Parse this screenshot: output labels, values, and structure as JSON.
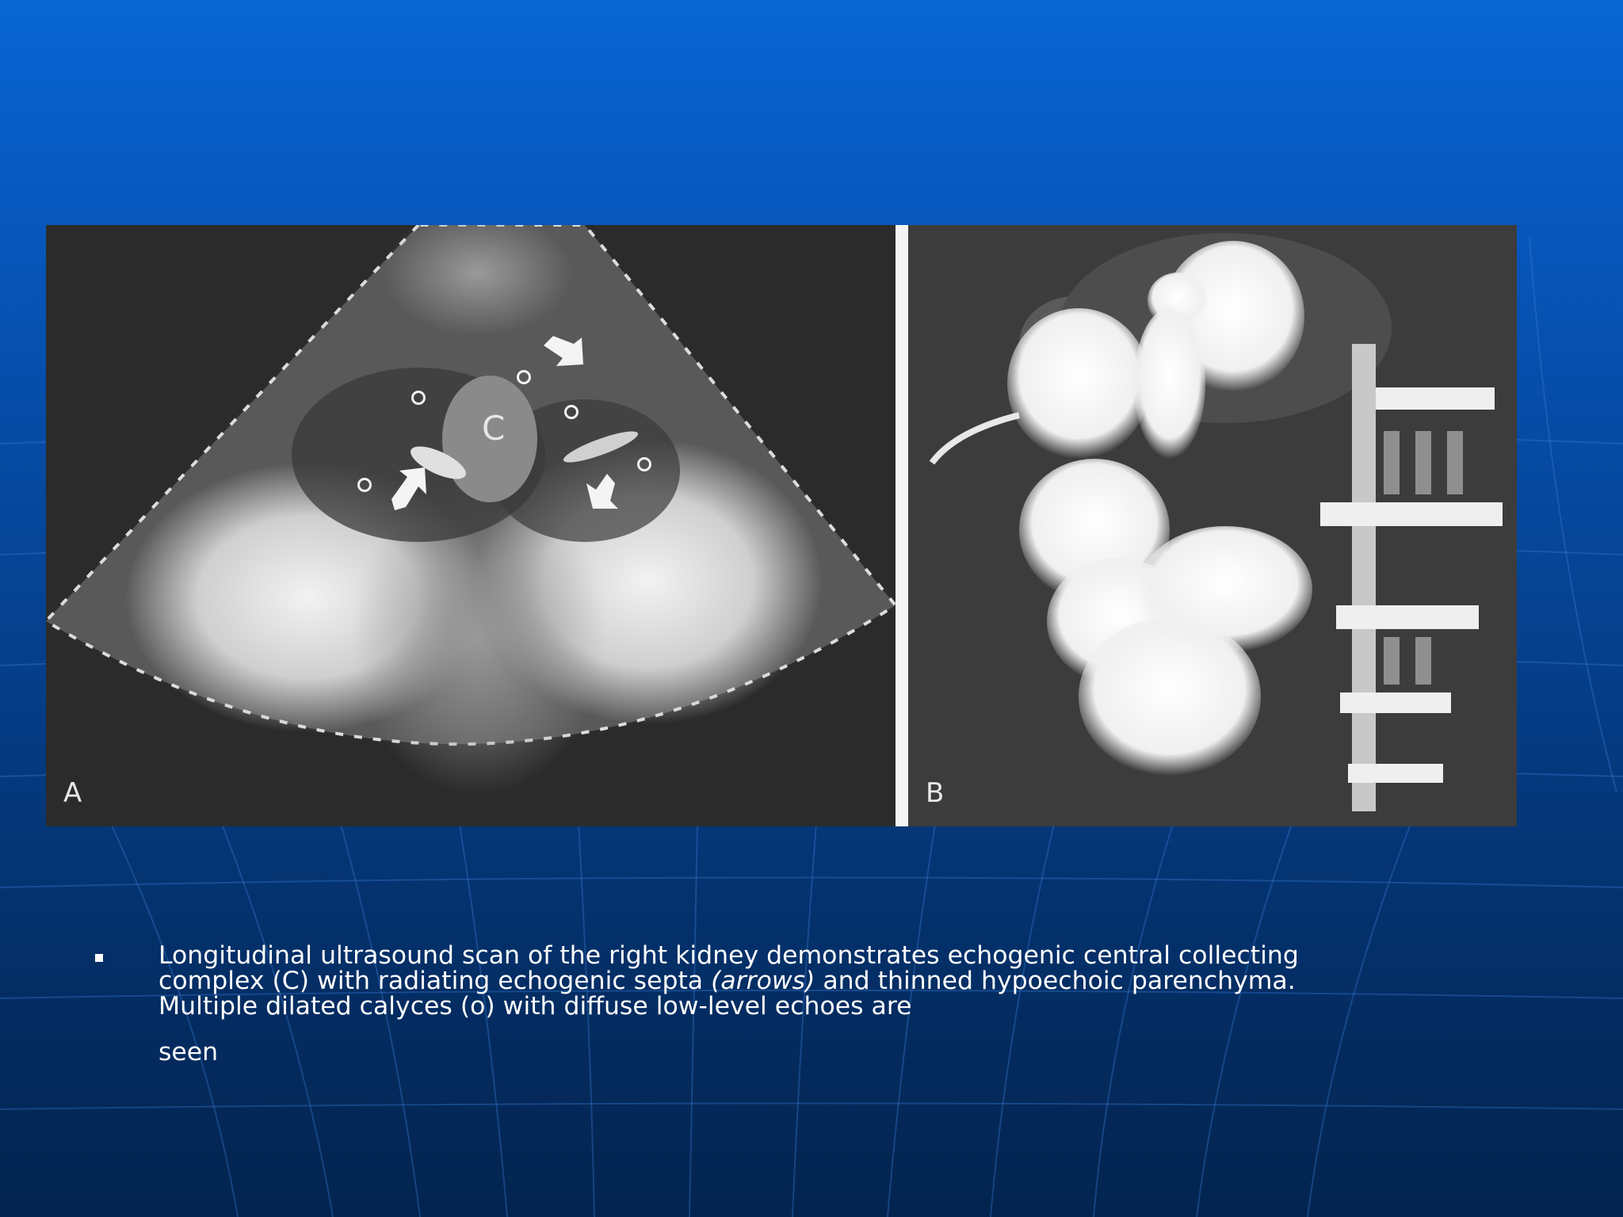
{
  "slide": {
    "panel_a_letter": "A",
    "panel_b_letter": "B",
    "center_label": "C",
    "caption_part1": "Longitudinal ultrasound scan of the right kidney demonstrates echogenic central collecting complex (C) with radiating echogenic septa ",
    "caption_italic": "(arrows)",
    "caption_part2": " and thinned hypoechoic parenchyma. Multiple dilated calyces (o) with diffuse low-level echoes are",
    "caption_tail": "seen"
  },
  "colors": {
    "background_top": "#0866d4",
    "background_bottom": "#03244f",
    "text": "#ffffff"
  }
}
